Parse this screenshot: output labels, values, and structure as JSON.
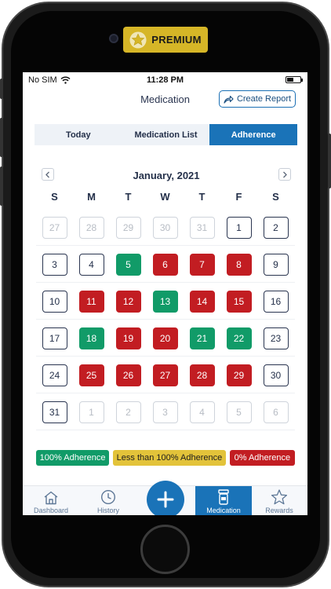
{
  "premium": {
    "label": "PREMIUM"
  },
  "status_bar": {
    "carrier": "No SIM",
    "time": "11:28 PM"
  },
  "header": {
    "title": "Medication",
    "create_report_label": "Create Report"
  },
  "tabs": [
    {
      "label": "Today",
      "active": false
    },
    {
      "label": "Medication List",
      "active": false
    },
    {
      "label": "Adherence",
      "active": true
    }
  ],
  "calendar": {
    "month_label": "January, 2021",
    "weekdays": [
      "S",
      "M",
      "T",
      "W",
      "T",
      "F",
      "S"
    ],
    "weeks": [
      [
        {
          "day": "27",
          "status": "muted"
        },
        {
          "day": "28",
          "status": "muted"
        },
        {
          "day": "29",
          "status": "muted"
        },
        {
          "day": "30",
          "status": "muted"
        },
        {
          "day": "31",
          "status": "muted"
        },
        {
          "day": "1",
          "status": "none"
        },
        {
          "day": "2",
          "status": "none"
        }
      ],
      [
        {
          "day": "3",
          "status": "none"
        },
        {
          "day": "4",
          "status": "none"
        },
        {
          "day": "5",
          "status": "full"
        },
        {
          "day": "6",
          "status": "zero"
        },
        {
          "day": "7",
          "status": "zero"
        },
        {
          "day": "8",
          "status": "zero"
        },
        {
          "day": "9",
          "status": "none"
        }
      ],
      [
        {
          "day": "10",
          "status": "none"
        },
        {
          "day": "11",
          "status": "zero"
        },
        {
          "day": "12",
          "status": "zero"
        },
        {
          "day": "13",
          "status": "full"
        },
        {
          "day": "14",
          "status": "zero"
        },
        {
          "day": "15",
          "status": "zero"
        },
        {
          "day": "16",
          "status": "none"
        }
      ],
      [
        {
          "day": "17",
          "status": "none"
        },
        {
          "day": "18",
          "status": "full"
        },
        {
          "day": "19",
          "status": "zero"
        },
        {
          "day": "20",
          "status": "zero"
        },
        {
          "day": "21",
          "status": "full"
        },
        {
          "day": "22",
          "status": "full"
        },
        {
          "day": "23",
          "status": "none"
        }
      ],
      [
        {
          "day": "24",
          "status": "none"
        },
        {
          "day": "25",
          "status": "zero"
        },
        {
          "day": "26",
          "status": "zero"
        },
        {
          "day": "27",
          "status": "zero"
        },
        {
          "day": "28",
          "status": "zero"
        },
        {
          "day": "29",
          "status": "zero"
        },
        {
          "day": "30",
          "status": "none"
        }
      ],
      [
        {
          "day": "31",
          "status": "none"
        },
        {
          "day": "1",
          "status": "muted"
        },
        {
          "day": "2",
          "status": "muted"
        },
        {
          "day": "3",
          "status": "muted"
        },
        {
          "day": "4",
          "status": "muted"
        },
        {
          "day": "5",
          "status": "muted"
        },
        {
          "day": "6",
          "status": "muted"
        }
      ]
    ]
  },
  "legend": {
    "full": "100% Adherence",
    "partial": "Less than 100% Adherence",
    "zero": "0% Adherence"
  },
  "colors": {
    "primary": "#1a73b8",
    "full_adherence": "#119b68",
    "partial_adherence": "#e3c33a",
    "zero_adherence": "#c21d22",
    "premium_badge": "#d6b627"
  },
  "tab_bar": [
    {
      "label": "Dashboard",
      "icon": "home-icon",
      "active": false
    },
    {
      "label": "History",
      "icon": "clock-icon",
      "active": false
    },
    {
      "label": "Medication",
      "icon": "pill-bottle-icon",
      "active": true
    },
    {
      "label": "Rewards",
      "icon": "star-icon",
      "active": false
    }
  ],
  "fab": {
    "icon": "plus-icon"
  }
}
